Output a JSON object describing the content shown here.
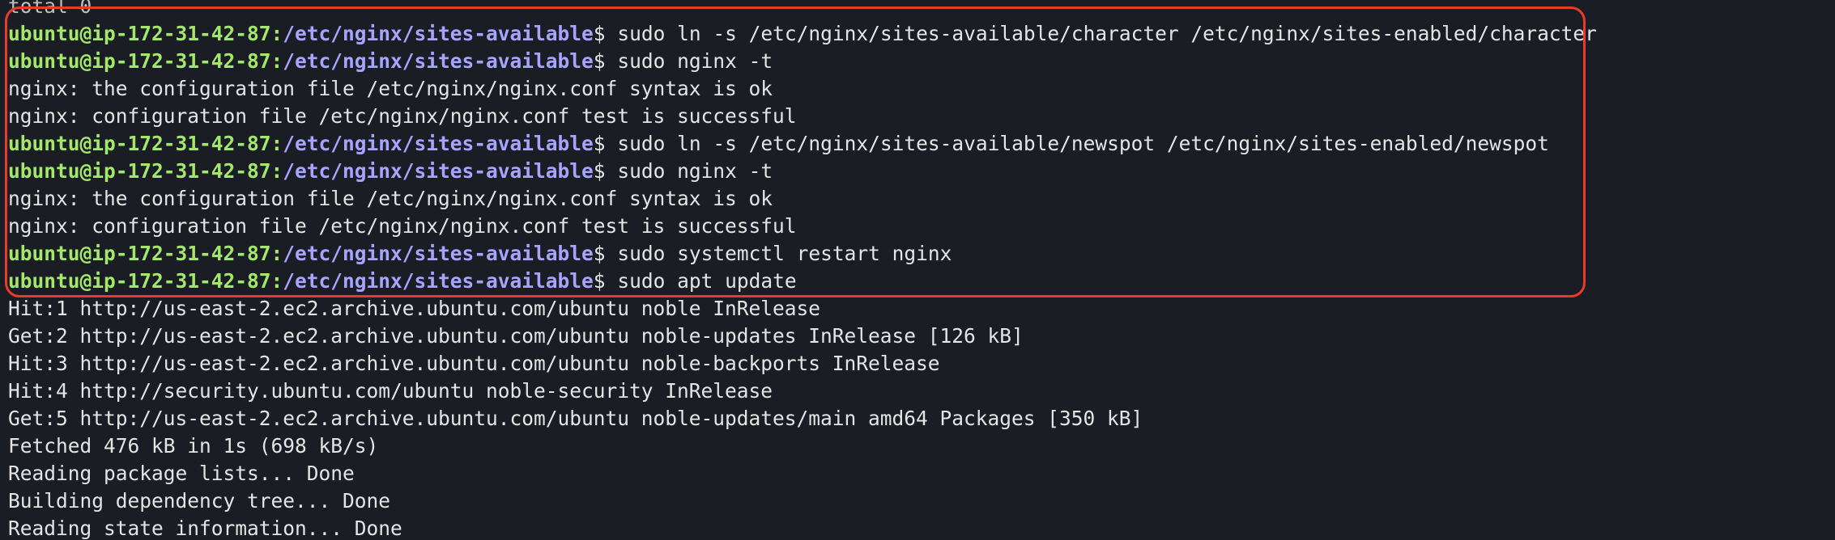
{
  "terminal": {
    "partial_top": "total 0",
    "prompt": {
      "user_host": "ubuntu@ip-172-31-42-87",
      "separator": ":",
      "path": "/etc/nginx/sites-available",
      "symbol": "$"
    },
    "lines": [
      {
        "type": "prompt",
        "command": " sudo ln -s /etc/nginx/sites-available/character /etc/nginx/sites-enabled/character"
      },
      {
        "type": "prompt",
        "command": " sudo nginx -t"
      },
      {
        "type": "output",
        "text": "nginx: the configuration file /etc/nginx/nginx.conf syntax is ok"
      },
      {
        "type": "output",
        "text": "nginx: configuration file /etc/nginx/nginx.conf test is successful"
      },
      {
        "type": "prompt",
        "command": " sudo ln -s /etc/nginx/sites-available/newspot /etc/nginx/sites-enabled/newspot"
      },
      {
        "type": "prompt",
        "command": " sudo nginx -t"
      },
      {
        "type": "output",
        "text": "nginx: the configuration file /etc/nginx/nginx.conf syntax is ok"
      },
      {
        "type": "output",
        "text": "nginx: configuration file /etc/nginx/nginx.conf test is successful"
      },
      {
        "type": "prompt",
        "command": " sudo systemctl restart nginx"
      },
      {
        "type": "prompt",
        "command": " sudo apt update"
      },
      {
        "type": "output",
        "text": "Hit:1 http://us-east-2.ec2.archive.ubuntu.com/ubuntu noble InRelease"
      },
      {
        "type": "output",
        "text": "Get:2 http://us-east-2.ec2.archive.ubuntu.com/ubuntu noble-updates InRelease [126 kB]"
      },
      {
        "type": "output",
        "text": "Hit:3 http://us-east-2.ec2.archive.ubuntu.com/ubuntu noble-backports InRelease"
      },
      {
        "type": "output",
        "text": "Hit:4 http://security.ubuntu.com/ubuntu noble-security InRelease"
      },
      {
        "type": "output",
        "text": "Get:5 http://us-east-2.ec2.archive.ubuntu.com/ubuntu noble-updates/main amd64 Packages [350 kB]"
      },
      {
        "type": "output",
        "text": "Fetched 476 kB in 1s (698 kB/s)"
      },
      {
        "type": "output",
        "text": "Reading package lists... Done"
      },
      {
        "type": "output",
        "text": "Building dependency tree... Done"
      },
      {
        "type": "output",
        "text": "Reading state information... Done"
      }
    ]
  },
  "colors": {
    "background": "#1b1d24",
    "prompt_user": "#a3e86b",
    "prompt_path": "#a7a4ff",
    "text": "#e4e4e4",
    "highlight_border": "#ea3b2a"
  }
}
